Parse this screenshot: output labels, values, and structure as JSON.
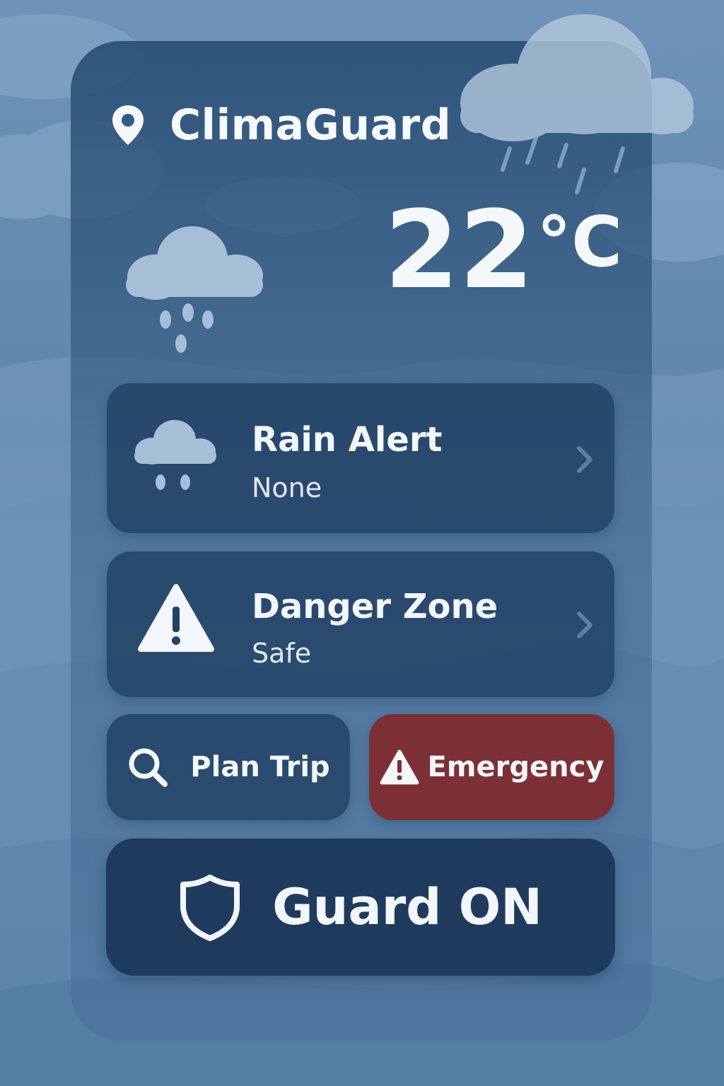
{
  "app": {
    "title": "ClimaGuard"
  },
  "weather": {
    "temperature": "22",
    "unit": "°C"
  },
  "cards": [
    {
      "title": "Rain Alert",
      "status": "None",
      "icon": "rain-cloud-icon"
    },
    {
      "title": "Danger Zone",
      "status": "Safe",
      "icon": "warning-icon"
    }
  ],
  "actions": {
    "plan_trip": {
      "label": "Plan Trip",
      "icon": "search-icon"
    },
    "emergency": {
      "label": "Emergency",
      "icon": "warning-icon",
      "color": "#7c3035"
    }
  },
  "guard": {
    "label": "Guard ON",
    "icon": "shield-icon"
  },
  "colors": {
    "background": "#6f93b8",
    "card": "#21416a",
    "text": "#f3f6fa"
  }
}
